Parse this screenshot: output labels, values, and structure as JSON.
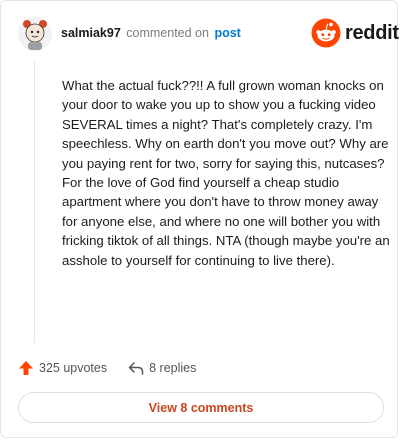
{
  "header": {
    "username": "salmiak97",
    "verb": "commented on",
    "post_link": "post",
    "brand": "reddit"
  },
  "comment": {
    "body": "What the actual fuck??!! A full grown woman knocks on your door to wake you up to show you a fucking video SEVERAL times a night? That's completely crazy. I'm speechless. Why on earth don't you move out? Why are you paying rent for two, sorry for saying this, nutcases? For the love of God find yourself a cheap studio apartment where you don't have to throw money away for anyone else, and where no one will bother you with fricking tiktok of all things. NTA (though maybe you're an asshole to yourself for continuing to live there)."
  },
  "footer": {
    "upvotes": "325 upvotes",
    "replies": "8 replies"
  },
  "view_comments_label": "View 8 comments",
  "colors": {
    "brand": "#ff4500",
    "link": "#0079d3",
    "button_text": "#c8461f"
  },
  "icons": [
    "avatar",
    "reddit-logo-icon",
    "upvote-arrow-icon",
    "reply-arrow-icon"
  ]
}
